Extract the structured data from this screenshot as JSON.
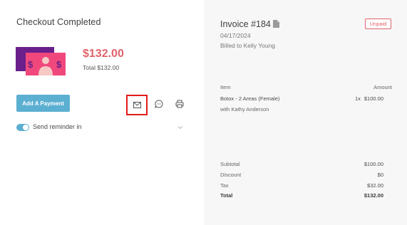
{
  "checkout": {
    "title": "Checkout Completed",
    "amount": "$132.00",
    "total_line": "Total $132.00",
    "add_payment_label": "Add A Payment",
    "reminder_label": "Send reminder in",
    "reminder_enabled": true,
    "icons": [
      "money-illustration",
      "email-icon",
      "chat-icon",
      "print-icon",
      "chevron-down-icon"
    ]
  },
  "invoice": {
    "title": "Invoice #184",
    "date": "04/17/2024",
    "billed_to": "Billed to Kelly Young",
    "status": "Unpaid",
    "columns": {
      "item": "Item",
      "amount": "Amount"
    },
    "lines": [
      {
        "name": "Botox - 2 Areas (Female)",
        "qty": "1x",
        "amount": "$100.00",
        "provider": "with Kathy Anderson"
      }
    ],
    "summary": {
      "subtotal_label": "Subtotal",
      "subtotal": "$100.00",
      "discount_label": "Discount",
      "discount": "$0",
      "tax_label": "Tax",
      "tax": "$32.00",
      "total_label": "Total",
      "total": "$132.00"
    }
  },
  "colors": {
    "accent": "#5bafd1",
    "amount": "#e0636b",
    "highlight": "#e01b1b",
    "panel_bg": "#f7f7f7"
  }
}
